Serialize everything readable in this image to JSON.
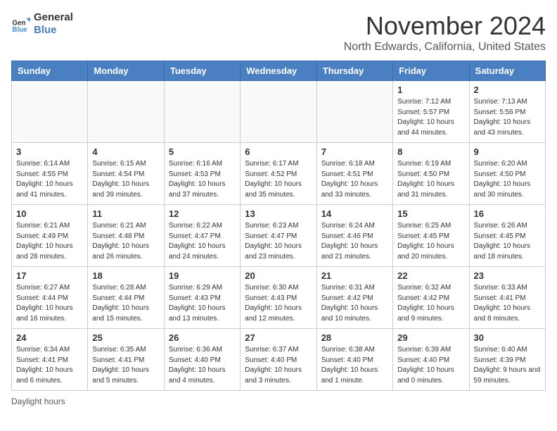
{
  "header": {
    "logo_line1": "General",
    "logo_line2": "Blue",
    "month": "November 2024",
    "location": "North Edwards, California, United States"
  },
  "days_of_week": [
    "Sunday",
    "Monday",
    "Tuesday",
    "Wednesday",
    "Thursday",
    "Friday",
    "Saturday"
  ],
  "weeks": [
    [
      {
        "day": "",
        "sunrise": "",
        "sunset": "",
        "daylight": ""
      },
      {
        "day": "",
        "sunrise": "",
        "sunset": "",
        "daylight": ""
      },
      {
        "day": "",
        "sunrise": "",
        "sunset": "",
        "daylight": ""
      },
      {
        "day": "",
        "sunrise": "",
        "sunset": "",
        "daylight": ""
      },
      {
        "day": "",
        "sunrise": "",
        "sunset": "",
        "daylight": ""
      },
      {
        "day": "1",
        "sunrise": "Sunrise: 7:12 AM",
        "sunset": "Sunset: 5:57 PM",
        "daylight": "Daylight: 10 hours and 44 minutes."
      },
      {
        "day": "2",
        "sunrise": "Sunrise: 7:13 AM",
        "sunset": "Sunset: 5:56 PM",
        "daylight": "Daylight: 10 hours and 43 minutes."
      }
    ],
    [
      {
        "day": "3",
        "sunrise": "Sunrise: 6:14 AM",
        "sunset": "Sunset: 4:55 PM",
        "daylight": "Daylight: 10 hours and 41 minutes."
      },
      {
        "day": "4",
        "sunrise": "Sunrise: 6:15 AM",
        "sunset": "Sunset: 4:54 PM",
        "daylight": "Daylight: 10 hours and 39 minutes."
      },
      {
        "day": "5",
        "sunrise": "Sunrise: 6:16 AM",
        "sunset": "Sunset: 4:53 PM",
        "daylight": "Daylight: 10 hours and 37 minutes."
      },
      {
        "day": "6",
        "sunrise": "Sunrise: 6:17 AM",
        "sunset": "Sunset: 4:52 PM",
        "daylight": "Daylight: 10 hours and 35 minutes."
      },
      {
        "day": "7",
        "sunrise": "Sunrise: 6:18 AM",
        "sunset": "Sunset: 4:51 PM",
        "daylight": "Daylight: 10 hours and 33 minutes."
      },
      {
        "day": "8",
        "sunrise": "Sunrise: 6:19 AM",
        "sunset": "Sunset: 4:50 PM",
        "daylight": "Daylight: 10 hours and 31 minutes."
      },
      {
        "day": "9",
        "sunrise": "Sunrise: 6:20 AM",
        "sunset": "Sunset: 4:50 PM",
        "daylight": "Daylight: 10 hours and 30 minutes."
      }
    ],
    [
      {
        "day": "10",
        "sunrise": "Sunrise: 6:21 AM",
        "sunset": "Sunset: 4:49 PM",
        "daylight": "Daylight: 10 hours and 28 minutes."
      },
      {
        "day": "11",
        "sunrise": "Sunrise: 6:21 AM",
        "sunset": "Sunset: 4:48 PM",
        "daylight": "Daylight: 10 hours and 26 minutes."
      },
      {
        "day": "12",
        "sunrise": "Sunrise: 6:22 AM",
        "sunset": "Sunset: 4:47 PM",
        "daylight": "Daylight: 10 hours and 24 minutes."
      },
      {
        "day": "13",
        "sunrise": "Sunrise: 6:23 AM",
        "sunset": "Sunset: 4:47 PM",
        "daylight": "Daylight: 10 hours and 23 minutes."
      },
      {
        "day": "14",
        "sunrise": "Sunrise: 6:24 AM",
        "sunset": "Sunset: 4:46 PM",
        "daylight": "Daylight: 10 hours and 21 minutes."
      },
      {
        "day": "15",
        "sunrise": "Sunrise: 6:25 AM",
        "sunset": "Sunset: 4:45 PM",
        "daylight": "Daylight: 10 hours and 20 minutes."
      },
      {
        "day": "16",
        "sunrise": "Sunrise: 6:26 AM",
        "sunset": "Sunset: 4:45 PM",
        "daylight": "Daylight: 10 hours and 18 minutes."
      }
    ],
    [
      {
        "day": "17",
        "sunrise": "Sunrise: 6:27 AM",
        "sunset": "Sunset: 4:44 PM",
        "daylight": "Daylight: 10 hours and 16 minutes."
      },
      {
        "day": "18",
        "sunrise": "Sunrise: 6:28 AM",
        "sunset": "Sunset: 4:44 PM",
        "daylight": "Daylight: 10 hours and 15 minutes."
      },
      {
        "day": "19",
        "sunrise": "Sunrise: 6:29 AM",
        "sunset": "Sunset: 4:43 PM",
        "daylight": "Daylight: 10 hours and 13 minutes."
      },
      {
        "day": "20",
        "sunrise": "Sunrise: 6:30 AM",
        "sunset": "Sunset: 4:43 PM",
        "daylight": "Daylight: 10 hours and 12 minutes."
      },
      {
        "day": "21",
        "sunrise": "Sunrise: 6:31 AM",
        "sunset": "Sunset: 4:42 PM",
        "daylight": "Daylight: 10 hours and 10 minutes."
      },
      {
        "day": "22",
        "sunrise": "Sunrise: 6:32 AM",
        "sunset": "Sunset: 4:42 PM",
        "daylight": "Daylight: 10 hours and 9 minutes."
      },
      {
        "day": "23",
        "sunrise": "Sunrise: 6:33 AM",
        "sunset": "Sunset: 4:41 PM",
        "daylight": "Daylight: 10 hours and 8 minutes."
      }
    ],
    [
      {
        "day": "24",
        "sunrise": "Sunrise: 6:34 AM",
        "sunset": "Sunset: 4:41 PM",
        "daylight": "Daylight: 10 hours and 6 minutes."
      },
      {
        "day": "25",
        "sunrise": "Sunrise: 6:35 AM",
        "sunset": "Sunset: 4:41 PM",
        "daylight": "Daylight: 10 hours and 5 minutes."
      },
      {
        "day": "26",
        "sunrise": "Sunrise: 6:36 AM",
        "sunset": "Sunset: 4:40 PM",
        "daylight": "Daylight: 10 hours and 4 minutes."
      },
      {
        "day": "27",
        "sunrise": "Sunrise: 6:37 AM",
        "sunset": "Sunset: 4:40 PM",
        "daylight": "Daylight: 10 hours and 3 minutes."
      },
      {
        "day": "28",
        "sunrise": "Sunrise: 6:38 AM",
        "sunset": "Sunset: 4:40 PM",
        "daylight": "Daylight: 10 hours and 1 minute."
      },
      {
        "day": "29",
        "sunrise": "Sunrise: 6:39 AM",
        "sunset": "Sunset: 4:40 PM",
        "daylight": "Daylight: 10 hours and 0 minutes."
      },
      {
        "day": "30",
        "sunrise": "Sunrise: 6:40 AM",
        "sunset": "Sunset: 4:39 PM",
        "daylight": "Daylight: 9 hours and 59 minutes."
      }
    ]
  ],
  "footer": {
    "daylight_label": "Daylight hours"
  }
}
